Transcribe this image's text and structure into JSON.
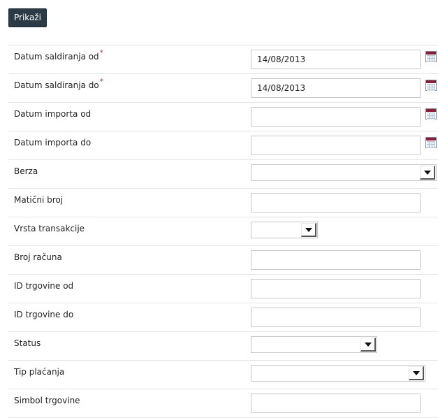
{
  "toolbar": {
    "show_label": "Prikaži"
  },
  "form": {
    "rows": [
      {
        "label": "Datum saldiranja od",
        "required": true,
        "value": "14/08/2013"
      },
      {
        "label": "Datum saldiranja do",
        "required": true,
        "value": "14/08/2013"
      },
      {
        "label": "Datum importa od",
        "value": ""
      },
      {
        "label": "Datum importa do",
        "value": ""
      },
      {
        "label": "Berza",
        "value": ""
      },
      {
        "label": "Matični broj",
        "value": ""
      },
      {
        "label": "Vrsta transakcije",
        "value": ""
      },
      {
        "label": "Broj računa",
        "value": ""
      },
      {
        "label": "ID trgovine od",
        "value": ""
      },
      {
        "label": "ID trgovine do",
        "value": ""
      },
      {
        "label": "Status",
        "value": ""
      },
      {
        "label": "Tip plaćanja",
        "value": ""
      },
      {
        "label": "Simbol trgovine",
        "value": ""
      }
    ],
    "required_marker": "*"
  },
  "icons": {
    "calendar": "calendar-icon",
    "dropdown": "chevron-down-icon"
  },
  "colors": {
    "button_bg": "#2b3a45",
    "required": "#d43a3a",
    "calendar_header": "#8b1f3a"
  }
}
